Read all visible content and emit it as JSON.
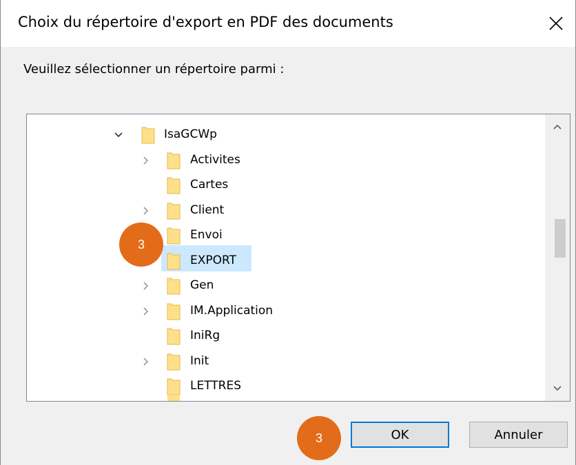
{
  "dialog": {
    "title": "Choix du répertoire d'export en PDF des documents",
    "prompt": "Veuillez sélectionner un répertoire parmi :",
    "close_icon": "close-icon"
  },
  "tree": {
    "items": [
      {
        "label": "IsaGCWp",
        "expander": "expanded",
        "selected": false
      },
      {
        "label": "Activites",
        "expander": "collapsed",
        "selected": false
      },
      {
        "label": "Cartes",
        "expander": "none",
        "selected": false
      },
      {
        "label": "Client",
        "expander": "collapsed",
        "selected": false
      },
      {
        "label": "Envoi",
        "expander": "none",
        "selected": false
      },
      {
        "label": "EXPORT",
        "expander": "none",
        "selected": true
      },
      {
        "label": "Gen",
        "expander": "collapsed",
        "selected": false
      },
      {
        "label": "IM.Application",
        "expander": "collapsed",
        "selected": false
      },
      {
        "label": "IniRg",
        "expander": "none",
        "selected": false
      },
      {
        "label": "Init",
        "expander": "collapsed",
        "selected": false
      },
      {
        "label": "LETTRES",
        "expander": "none",
        "selected": false
      }
    ]
  },
  "buttons": {
    "ok": "OK",
    "cancel": "Annuler"
  },
  "badges": {
    "tree_step": "3",
    "ok_step": "3"
  },
  "colors": {
    "badge": "#e36c1a",
    "selection": "#cce8ff",
    "folder": "#ffe08a",
    "accent": "#0078d7"
  }
}
